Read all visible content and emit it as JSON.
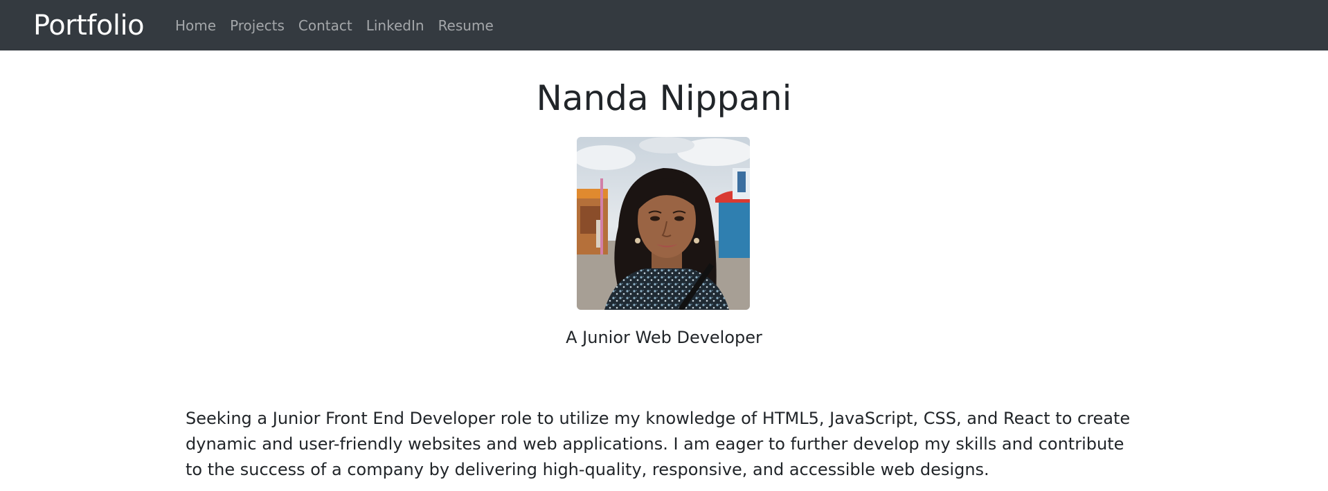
{
  "navbar": {
    "brand": "Portfolio",
    "links": [
      "Home",
      "Projects",
      "Contact",
      "LinkedIn",
      "Resume"
    ]
  },
  "profile": {
    "name": "Nanda Nippani",
    "photo_icon": "profile-photo",
    "subtitle": "A Junior Web Developer",
    "bio": "Seeking a Junior Front End Developer role to utilize my knowledge of HTML5, JavaScript, CSS, and React to create dynamic and user-friendly websites and web applications. I am eager to further develop my skills and contribute to the success of a company by delivering high-quality, responsive, and accessible web designs."
  },
  "colors": {
    "navbar_bg": "#343a40",
    "brand": "#ffffff",
    "nav_link": "rgba(255,255,255,0.55)",
    "text": "#212529"
  }
}
